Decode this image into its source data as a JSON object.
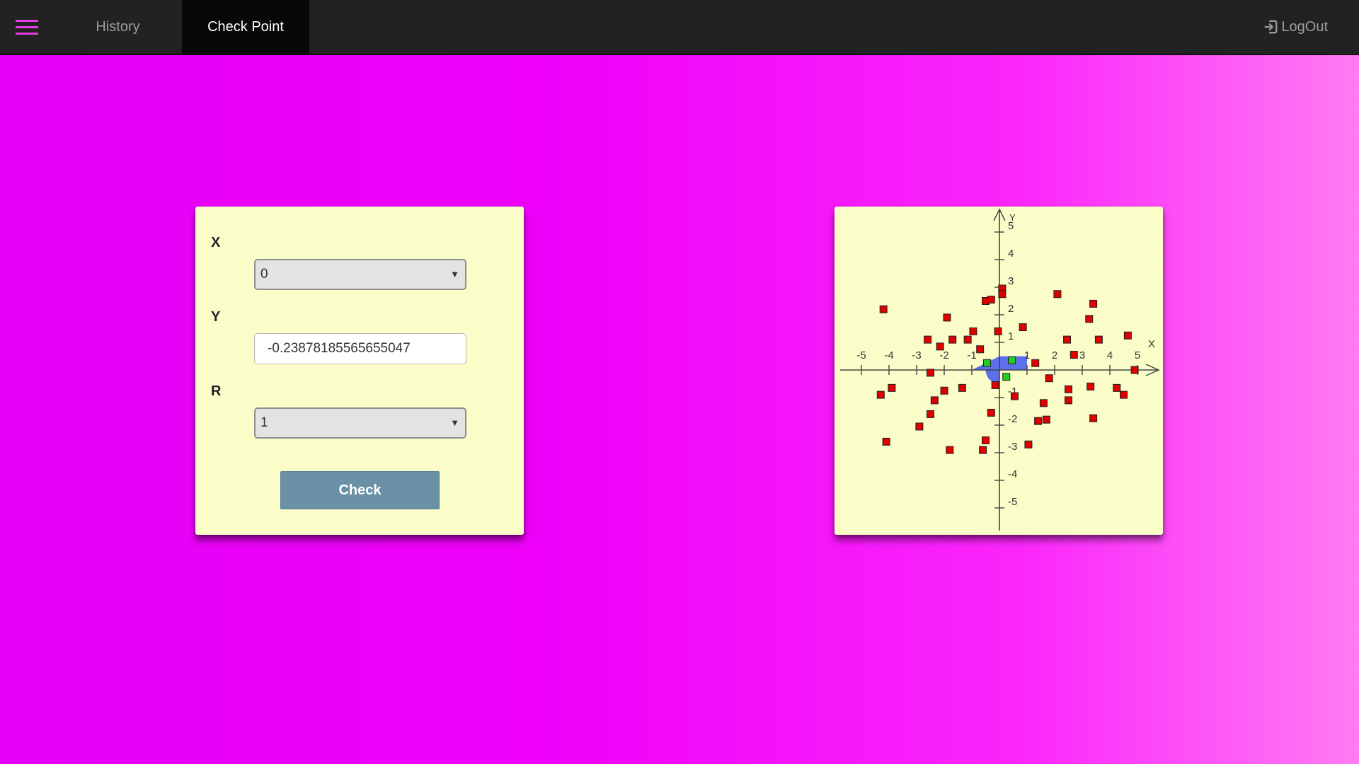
{
  "nav": {
    "tabs": [
      {
        "label": "History",
        "active": false
      },
      {
        "label": "Check Point",
        "active": true
      }
    ],
    "logout_label": "LogOut",
    "menu_icon": "hamburger-icon",
    "logout_icon": "sign-in-icon",
    "accent_color": "#e63de6"
  },
  "form": {
    "x_label": "X",
    "x_value": "0",
    "y_label": "Y",
    "y_value": "-0.23878185565655047",
    "r_label": "R",
    "r_value": "1",
    "check_label": "Check"
  },
  "chart_data": {
    "type": "scatter",
    "xlabel": "X",
    "ylabel": "Y",
    "xlim": [
      -5.5,
      5.5
    ],
    "ylim": [
      -5.5,
      5.5
    ],
    "x_ticks": [
      -5,
      -4,
      -3,
      -2,
      -1,
      1,
      2,
      3,
      4,
      5
    ],
    "y_ticks": [
      5,
      4,
      3,
      2,
      1,
      -1,
      -2,
      -3,
      -4,
      -5
    ],
    "tick_labels_x": [
      "-5",
      "-4",
      "-3",
      "-2",
      "-1",
      "1",
      "2",
      "3",
      "4",
      "5"
    ],
    "tick_labels_y": [
      "5",
      "4",
      "3",
      "2",
      "1",
      "-1",
      "-2",
      "-3",
      "-4",
      "-5"
    ],
    "area_color": "#5567ee",
    "series": [
      {
        "color": "#dd0000",
        "points": [
          [
            -4.2,
            2.2
          ],
          [
            -4.3,
            -0.9
          ],
          [
            -3.9,
            -0.65
          ],
          [
            -4.1,
            -2.6
          ],
          [
            -2.6,
            1.1
          ],
          [
            -2.15,
            0.85
          ],
          [
            -1.9,
            1.9
          ],
          [
            -1.7,
            1.1
          ],
          [
            -1.15,
            1.1
          ],
          [
            -0.95,
            1.4
          ],
          [
            -0.7,
            0.75
          ],
          [
            -0.5,
            2.5
          ],
          [
            -0.3,
            2.55
          ],
          [
            -0.15,
            -0.55
          ],
          [
            -0.05,
            1.4
          ],
          [
            0.1,
            2.95
          ],
          [
            0.1,
            2.75
          ],
          [
            0.85,
            1.55
          ],
          [
            0.55,
            -0.95
          ],
          [
            1.3,
            0.25
          ],
          [
            2.1,
            2.75
          ],
          [
            2.45,
            1.1
          ],
          [
            2.7,
            0.55
          ],
          [
            3.25,
            1.85
          ],
          [
            3.4,
            2.4
          ],
          [
            3.6,
            1.1
          ],
          [
            4.65,
            1.25
          ],
          [
            4.9,
            0.0
          ],
          [
            1.8,
            -0.3
          ],
          [
            2.5,
            -0.7
          ],
          [
            2.5,
            -1.1
          ],
          [
            1.6,
            -1.2
          ],
          [
            1.7,
            -1.8
          ],
          [
            1.4,
            -1.85
          ],
          [
            3.3,
            -0.6
          ],
          [
            3.4,
            -1.75
          ],
          [
            4.25,
            -0.65
          ],
          [
            4.5,
            -0.9
          ],
          [
            -2.5,
            -0.1
          ],
          [
            -2.0,
            -0.75
          ],
          [
            -2.35,
            -1.1
          ],
          [
            -1.35,
            -0.65
          ],
          [
            -2.5,
            -1.6
          ],
          [
            -2.9,
            -2.05
          ],
          [
            -1.8,
            -2.9
          ],
          [
            -0.5,
            -2.55
          ],
          [
            -0.6,
            -2.9
          ],
          [
            -0.3,
            -1.55
          ],
          [
            1.05,
            -2.7
          ]
        ]
      },
      {
        "color": "#22cc22",
        "points": [
          [
            -0.45,
            0.25
          ],
          [
            0.45,
            0.35
          ],
          [
            0.25,
            -0.25
          ]
        ]
      }
    ]
  }
}
